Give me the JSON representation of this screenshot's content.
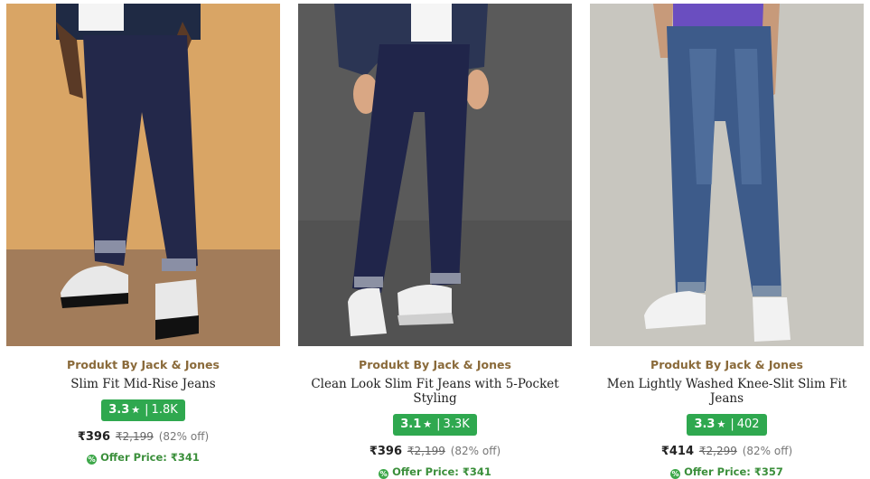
{
  "products": [
    {
      "brand": "Produkt By Jack & Jones",
      "title": "Slim Fit Mid-Rise Jeans",
      "rating": "3.3",
      "rating_count": "1.8K",
      "price": "₹396",
      "mrp": "₹2,199",
      "discount": "(82% off)",
      "offer_label": "Offer Price: ₹341",
      "image_alt": "Man wearing dark blue slim jeans and black-white sneakers"
    },
    {
      "brand": "Produkt By Jack & Jones",
      "title": "Clean Look Slim Fit Jeans with 5-Pocket Styling",
      "rating": "3.1",
      "rating_count": "3.3K",
      "price": "₹396",
      "mrp": "₹2,199",
      "discount": "(82% off)",
      "offer_label": "Offer Price: ₹341",
      "image_alt": "Man wearing dark blue clean look slim jeans and white sneakers"
    },
    {
      "brand": "Produkt By Jack & Jones",
      "title": "Men Lightly Washed Knee-Slit Slim Fit Jeans",
      "rating": "3.3",
      "rating_count": "402",
      "price": "₹414",
      "mrp": "₹2,299",
      "discount": "(82% off)",
      "offer_label": "Offer Price: ₹357",
      "image_alt": "Man wearing lightly washed blue jeans and white sneakers"
    }
  ],
  "colors": {
    "brand_text": "#8a6a3a",
    "rating_badge": "#2fa84f",
    "offer_text": "#3b8f3b"
  },
  "icons": {
    "rating": "star-icon",
    "offer": "offer-tag-icon"
  }
}
